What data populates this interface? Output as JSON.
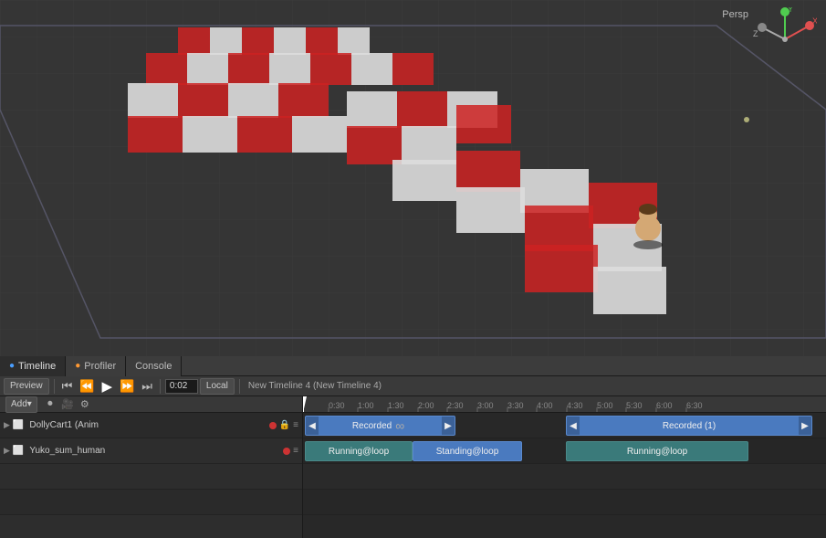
{
  "tabs": [
    {
      "id": "timeline",
      "label": "Timeline",
      "dot_color": "#4a9eff",
      "active": true
    },
    {
      "id": "profiler",
      "label": "Profiler",
      "dot_color": "#ff9933",
      "active": false
    },
    {
      "id": "console",
      "label": "Console",
      "dot_color": null,
      "active": false
    }
  ],
  "toolbar": {
    "preview_label": "Preview",
    "time_value": "0:02",
    "local_label": "Local",
    "add_label": "Add▾",
    "timeline_title": "New Timeline 4 (New Timeline 4)"
  },
  "ruler": {
    "marks": [
      "1:00",
      "1:30",
      "2:00",
      "2:30",
      "3:00",
      "3:30",
      "4:00",
      "4:30",
      "5:00",
      "5:30",
      "6:00",
      "6:30"
    ]
  },
  "tracks": [
    {
      "id": "dolly",
      "name": "DollyCart1 (Anim",
      "clips": [
        {
          "label": "Recorded",
          "type": "blue",
          "left_pct": 12,
          "width_pct": 22,
          "has_right_arrow": true,
          "has_infinity": true
        },
        {
          "label": "Recorded (1)",
          "type": "blue",
          "left_pct": 47,
          "width_pct": 37,
          "has_left_arrow": true,
          "has_right_arrow": false
        }
      ]
    },
    {
      "id": "yuko",
      "name": "Yuko_sum_human",
      "clips": [
        {
          "label": "Running@loop",
          "type": "teal",
          "left_pct": 12,
          "width_pct": 17
        },
        {
          "label": "Standing@loop",
          "type": "blue",
          "left_pct": 31,
          "width_pct": 18
        },
        {
          "label": "Running@loop",
          "type": "teal",
          "left_pct": 51,
          "width_pct": 25
        }
      ]
    }
  ],
  "viewport": {
    "persp_label": "Persp"
  },
  "gizmo": {
    "x_color": "#e05050",
    "y_color": "#50cc50",
    "z_color": "#5050e0"
  }
}
